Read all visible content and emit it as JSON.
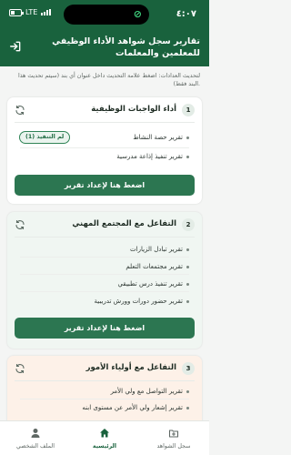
{
  "status_bar": {
    "time": "٤:٠٧",
    "network": "LTE"
  },
  "header": {
    "title": "تقارير سجل شواهد الأداء الوظيفي للمعلمين والمعلمات"
  },
  "hint": {
    "text": "لتحديث العدادات: اضغط علامة التحديث داخل عنوان أي بند (سيتم تحديث هذا البند فقط)."
  },
  "cards": [
    {
      "number": "1",
      "title": "أداء الواجبات الوظيفية",
      "items": [
        "تقرير حصة النشاط",
        "تقرير تنفيذ إذاعة مدرسية"
      ],
      "badge": "لم التنفيذ (1)",
      "button": "اضغط هنا لإعداد تقرير"
    },
    {
      "number": "2",
      "title": "التفاعل مع المجتمع المهني",
      "items": [
        "تقرير تبادل الزيارات",
        "تقرير مجتمعات التعلم",
        "تقرير تنفيذ درس تطبيقي",
        "تقرير حضور دورات وورش تدريبية"
      ],
      "button": "اضغط هنا لإعداد تقرير"
    },
    {
      "number": "3",
      "title": "التفاعل مع أولياء الأمور",
      "items": [
        "تقرير التواصل مع ولي الأمر",
        "تقرير إشعار ولي الأمر عن مستوى ابنه"
      ]
    }
  ],
  "bottom_nav": [
    {
      "label": "سجل الشواهد",
      "icon": "folder-add-icon"
    },
    {
      "label": "الرئيسية",
      "icon": "home-icon",
      "active": true
    },
    {
      "label": "الملف الشخصي",
      "icon": "person-icon"
    }
  ],
  "colors": {
    "primary": "#19623d",
    "button": "#2c7651",
    "badge_border": "#2f8456"
  }
}
